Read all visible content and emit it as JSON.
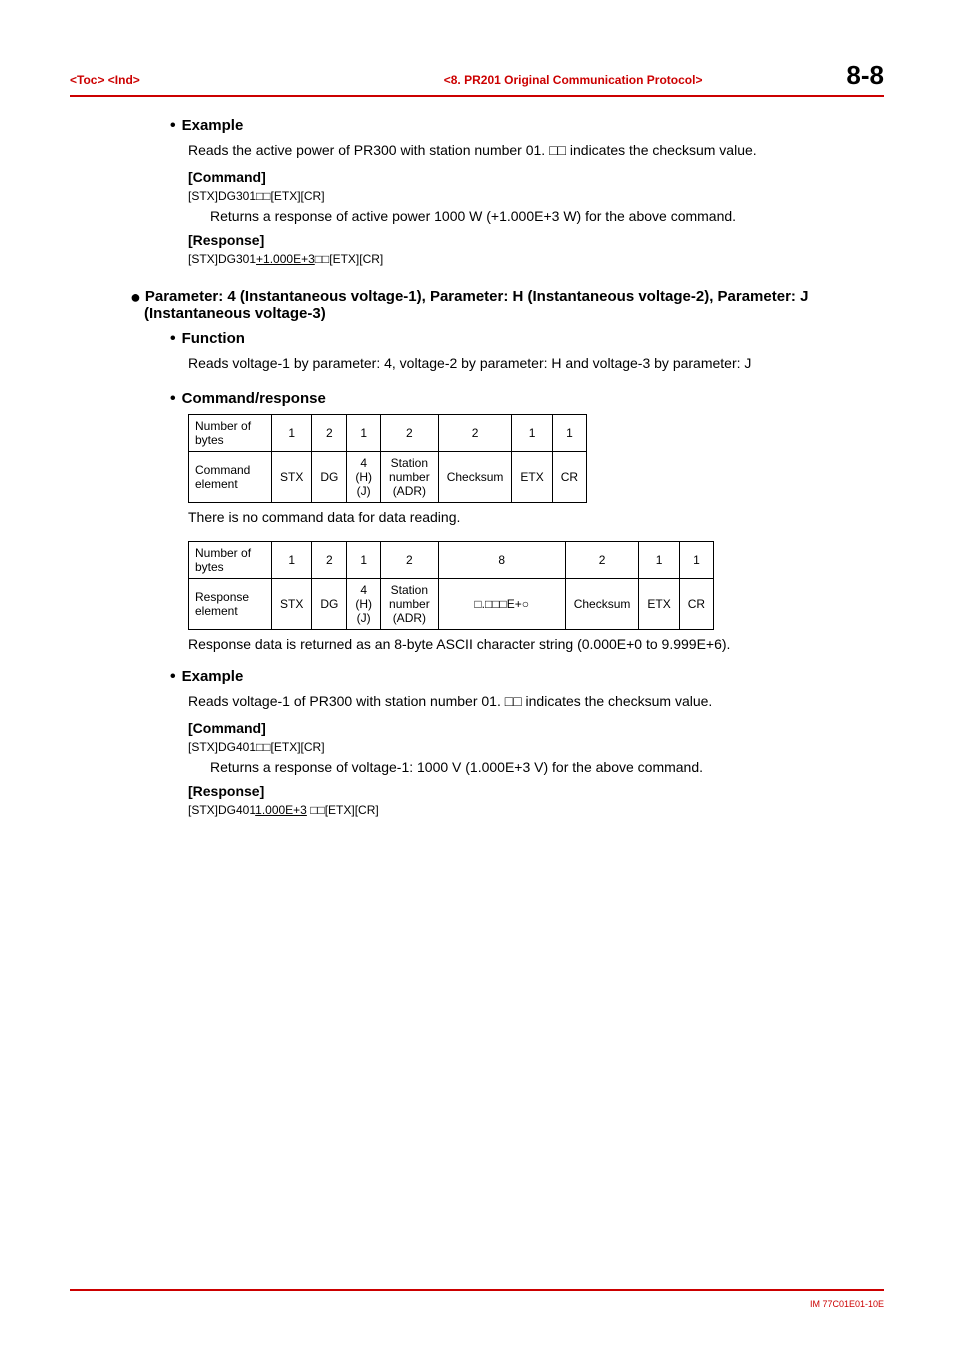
{
  "header": {
    "left": "<Toc> <Ind>",
    "center": "<8.  PR201 Original Communication Protocol>",
    "right": "8-8"
  },
  "example1": {
    "title": "Example",
    "text": "Reads the active power of PR300 with station number 01. □□ indicates the checksum value.",
    "command_label": "[Command]",
    "command_code": "[STX]DG301□□[ETX][CR]",
    "returns": "Returns a response of active power 1000 W (+1.000E+3 W) for the above command.",
    "response_label": "[Response]",
    "response_prefix": "[STX]DG301",
    "response_value": "+1.000E+3",
    "response_suffix": "□□[ETX][CR]"
  },
  "param_section": {
    "heading": "Parameter: 4 (Instantaneous voltage-1), Parameter: H (Instantaneous voltage-2), Parameter: J (Instantaneous voltage-3)"
  },
  "function": {
    "title": "Function",
    "text": "Reads voltage-1 by parameter: 4, voltage-2 by parameter: H and voltage-3 by parameter: J"
  },
  "cmdresp": {
    "title": "Command/response",
    "after_table1": "There is no command data for data reading.",
    "after_table2": "Response data is returned as an 8-byte ASCII character string (0.000E+0 to 9.999E+6)."
  },
  "table1": {
    "r0": {
      "c0": "Number of bytes",
      "c1": "1",
      "c2": "2",
      "c3": "1",
      "c4": "2",
      "c5": "2",
      "c6": "1",
      "c7": "1"
    },
    "r1": {
      "c0": "Command element",
      "c1": "STX",
      "c2": "DG",
      "c3": "4\n(H)\n(J)",
      "c4": "Station\nnumber\n(ADR)",
      "c5": "Checksum",
      "c6": "ETX",
      "c7": "CR"
    }
  },
  "table2": {
    "r0": {
      "c0": "Number of bytes",
      "c1": "1",
      "c2": "2",
      "c3": "1",
      "c4": "2",
      "c5": "8",
      "c6": "2",
      "c7": "1",
      "c8": "1"
    },
    "r1": {
      "c0": "Response element",
      "c1": "STX",
      "c2": "DG",
      "c3": "4\n(H)\n(J)",
      "c4": "Station\nnumber\n(ADR)",
      "c5": "□.□□□E+○",
      "c6": "Checksum",
      "c7": "ETX",
      "c8": "CR"
    }
  },
  "example2": {
    "title": "Example",
    "text": "Reads voltage-1 of PR300 with station number 01. □□ indicates the checksum value.",
    "command_label": "[Command]",
    "command_code": "[STX]DG401□□[ETX][CR]",
    "returns": "Returns a response of voltage-1: 1000 V (1.000E+3 V) for the above command.",
    "response_label": "[Response]",
    "response_prefix": "[STX]DG401",
    "response_value": "1.000E+3",
    "response_suffix": " □□[ETX][CR]"
  },
  "footer": "IM 77C01E01-10E"
}
